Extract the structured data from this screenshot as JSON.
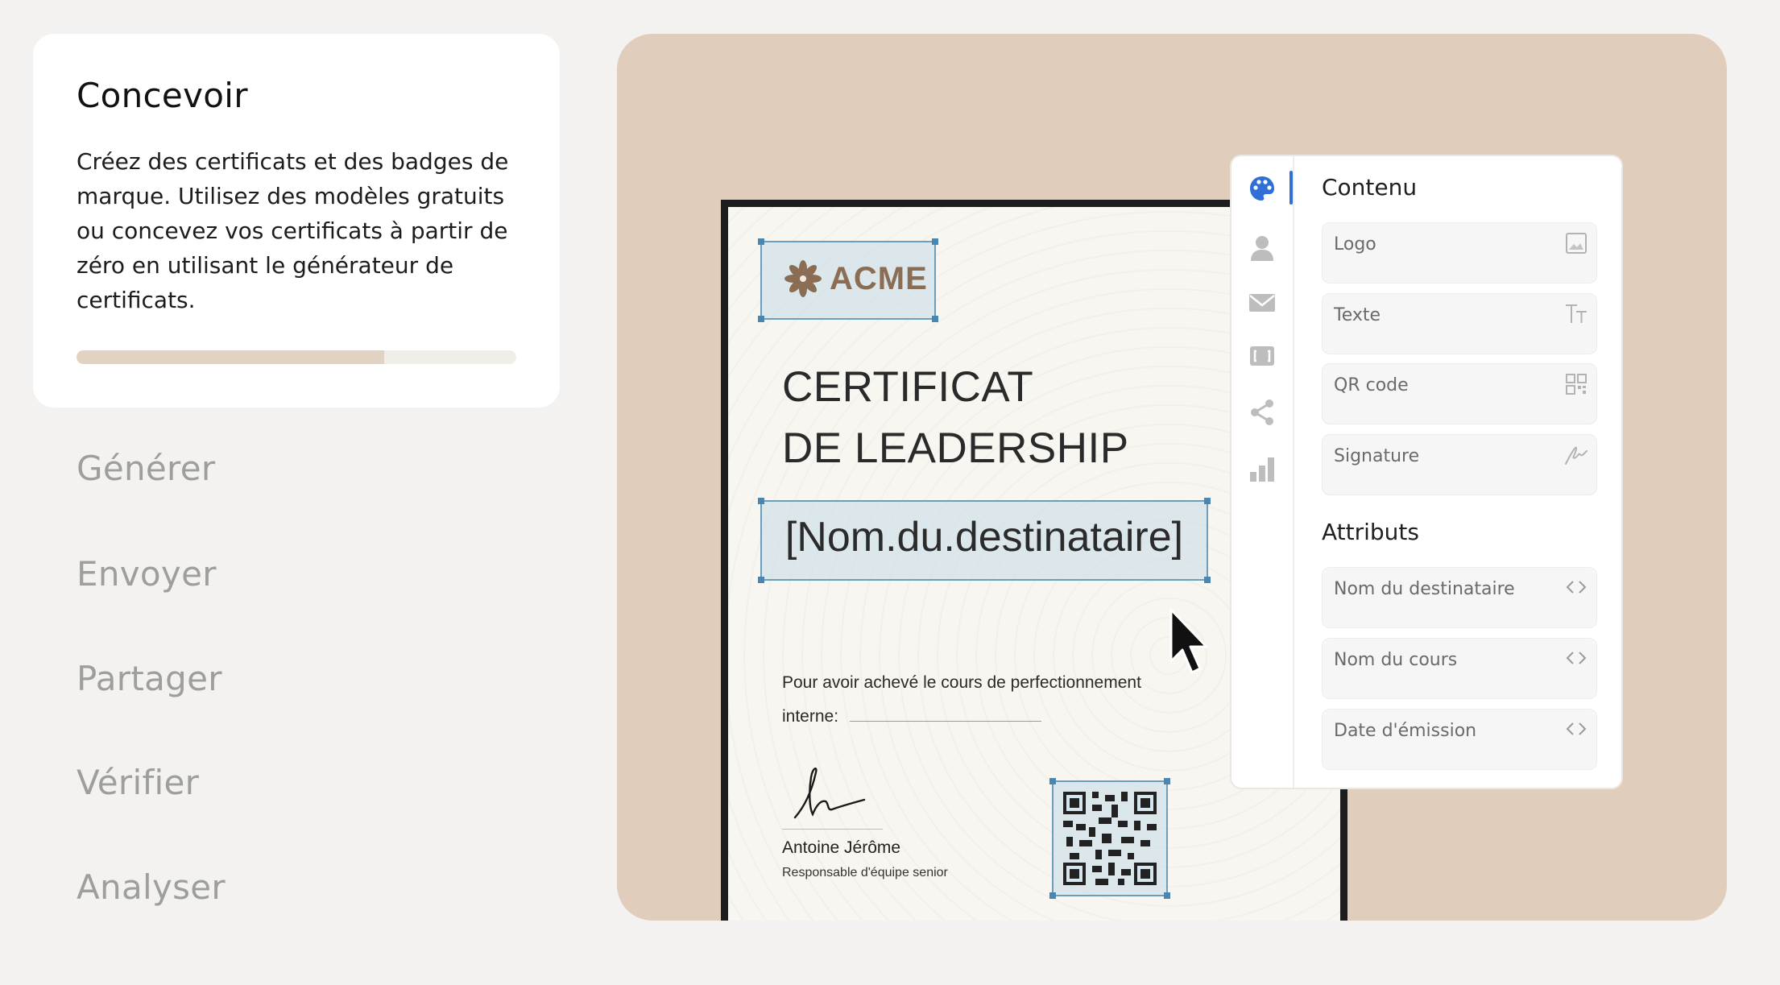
{
  "sidebar": {
    "active": {
      "title": "Concevoir",
      "description": "Créez des certificats et des badges de marque. Utilisez des modèles gratuits ou concevez vos certificats à partir de zéro en utilisant le générateur de certificats.",
      "progress": 0.7
    },
    "steps": [
      "Générer",
      "Envoyer",
      "Partager",
      "Vérifier",
      "Analyser"
    ]
  },
  "certificate": {
    "logo_text": "ACME",
    "title_line1": "CERTIFICAT",
    "title_line2": "DE LEADERSHIP",
    "recipient_placeholder": "[Nom.du.destinataire]",
    "body_line1": "Pour avoir achevé le cours de perfectionnement",
    "body_line2": "interne:",
    "signer_name": "Antoine Jérôme",
    "signer_role": "Responsable d'équipe senior"
  },
  "panel": {
    "content_header": "Contenu",
    "content_items": [
      {
        "label": "Logo",
        "icon": "image-icon"
      },
      {
        "label": "Texte",
        "icon": "text-icon"
      },
      {
        "label": "QR code",
        "icon": "qr-icon"
      },
      {
        "label": "Signature",
        "icon": "signature-icon"
      }
    ],
    "attributes_header": "Attributs",
    "attribute_items": [
      {
        "label": "Nom du destinataire",
        "icon": "code-icon"
      },
      {
        "label": "Nom du cours",
        "icon": "code-icon"
      },
      {
        "label": "Date d'émission",
        "icon": "code-icon"
      }
    ],
    "rail_icons": [
      "palette-icon",
      "user-icon",
      "mail-icon",
      "frame-icon",
      "share-icon",
      "chart-icon"
    ]
  },
  "colors": {
    "stage_bg": "#e0cdbb",
    "progress_fill": "#e1d2c1",
    "accent_blue": "#2f6fd6",
    "selection": "#6b9dbd",
    "logo_brown": "#8a6d52"
  }
}
